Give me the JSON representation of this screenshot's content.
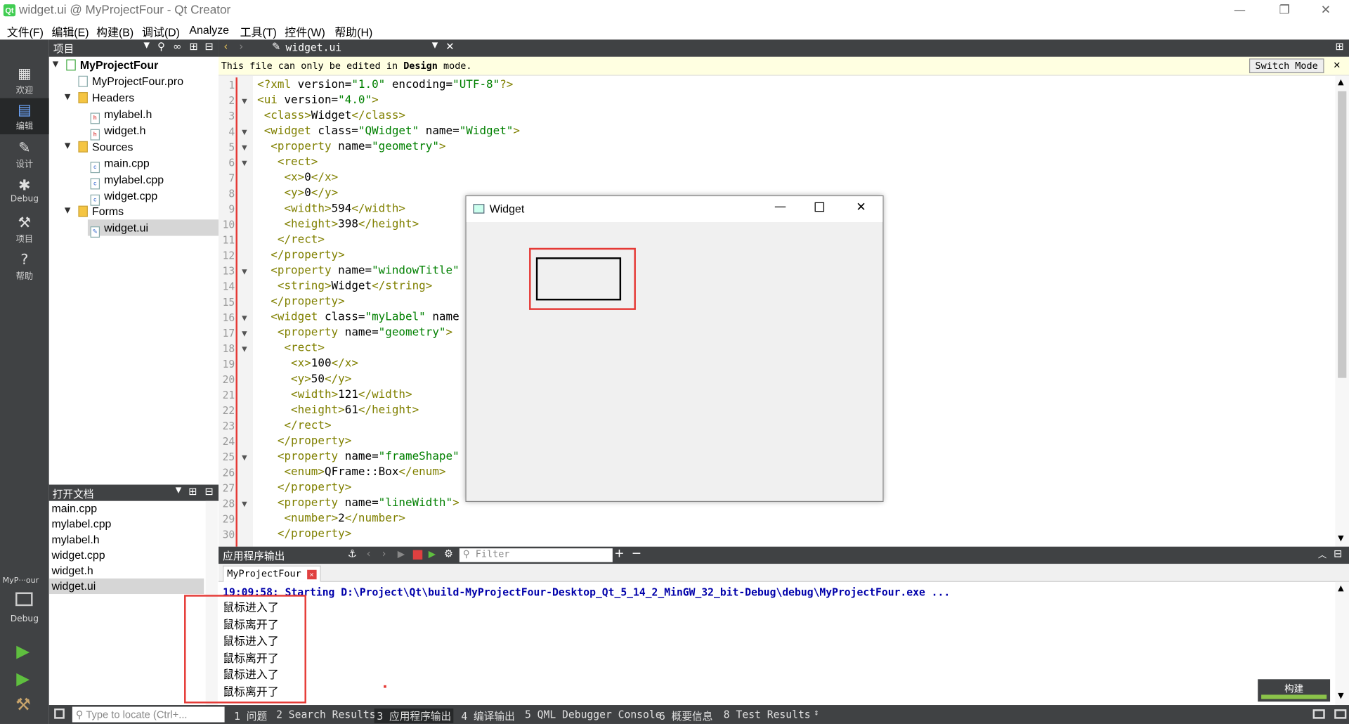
{
  "window": {
    "title": "widget.ui @ MyProjectFour - Qt Creator",
    "logo": "Qt"
  },
  "menubar": [
    "文件(F)",
    "编辑(E)",
    "构建(B)",
    "调试(D)",
    "Analyze",
    "工具(T)",
    "控件(W)",
    "帮助(H)"
  ],
  "modes": [
    {
      "label": "欢迎",
      "icon": "grid-icon"
    },
    {
      "label": "编辑",
      "icon": "edit-icon"
    },
    {
      "label": "设计",
      "icon": "pen-icon"
    },
    {
      "label": "Debug",
      "icon": "bug-icon"
    },
    {
      "label": "项目",
      "icon": "wrench-icon"
    },
    {
      "label": "帮助",
      "icon": "help-icon"
    }
  ],
  "target": {
    "project": "MyP···our",
    "config": "Debug"
  },
  "projects": {
    "header": "项目",
    "tree": [
      {
        "label": "MyProjectFour"
      },
      {
        "label": "MyProjectFour.pro"
      },
      {
        "label": "Headers"
      },
      {
        "label": "mylabel.h"
      },
      {
        "label": "widget.h"
      },
      {
        "label": "Sources"
      },
      {
        "label": "main.cpp"
      },
      {
        "label": "mylabel.cpp"
      },
      {
        "label": "widget.cpp"
      },
      {
        "label": "Forms"
      },
      {
        "label": "widget.ui"
      }
    ]
  },
  "open_docs": {
    "header": "打开文档",
    "items": [
      "main.cpp",
      "mylabel.cpp",
      "mylabel.h",
      "widget.cpp",
      "widget.h",
      "widget.ui"
    ]
  },
  "editor": {
    "file_tab": "widget.ui",
    "info_prefix": "This file can only be edited in ",
    "info_bold": "Design",
    "info_suffix": " mode.",
    "switch_mode": "Switch Mode",
    "lines": [
      "<?xml version=\"1.0\" encoding=\"UTF-8\"?>",
      "<ui version=\"4.0\">",
      " <class>Widget</class>",
      " <widget class=\"QWidget\" name=\"Widget\">",
      "  <property name=\"geometry\">",
      "   <rect>",
      "    <x>0</x>",
      "    <y>0</y>",
      "    <width>594</width>",
      "    <height>398</height>",
      "   </rect>",
      "  </property>",
      "  <property name=\"windowTitle\"",
      "   <string>Widget</string>",
      "  </property>",
      "  <widget class=\"myLabel\" name",
      "   <property name=\"geometry\">",
      "    <rect>",
      "     <x>100</x>",
      "     <y>50</y>",
      "     <width>121</width>",
      "     <height>61</height>",
      "    </rect>",
      "   </property>",
      "   <property name=\"frameShape\"",
      "    <enum>QFrame::Box</enum>",
      "   </property>",
      "   <property name=\"lineWidth\">",
      "    <number>2</number>",
      "   </property>"
    ]
  },
  "widget_window": {
    "title": "Widget"
  },
  "output": {
    "header": "应用程序输出",
    "filter_placeholder": "Filter",
    "tab": "MyProjectFour",
    "starting_line": "19:09:58: Starting D:\\Project\\Qt\\build-MyProjectFour-Desktop_Qt_5_14_2_MinGW_32_bit-Debug\\debug\\MyProjectFour.exe ...",
    "messages": [
      "鼠标进入了",
      "鼠标离开了",
      "鼠标进入了",
      "鼠标离开了",
      "鼠标进入了",
      "鼠标离开了"
    ],
    "build_label": "构建"
  },
  "statusbar": {
    "locate_placeholder": "Type to locate (Ctrl+...",
    "tabs": [
      "1 问题",
      "2 Search Results",
      "3 应用程序输出",
      "4 编译输出",
      "5 QML Debugger Console",
      "6 概要信息",
      "8 Test Results"
    ]
  },
  "colors": {
    "accent_red": "#e53935",
    "sidebar_dark": "#404244",
    "build_progress": "#8bc34a"
  }
}
